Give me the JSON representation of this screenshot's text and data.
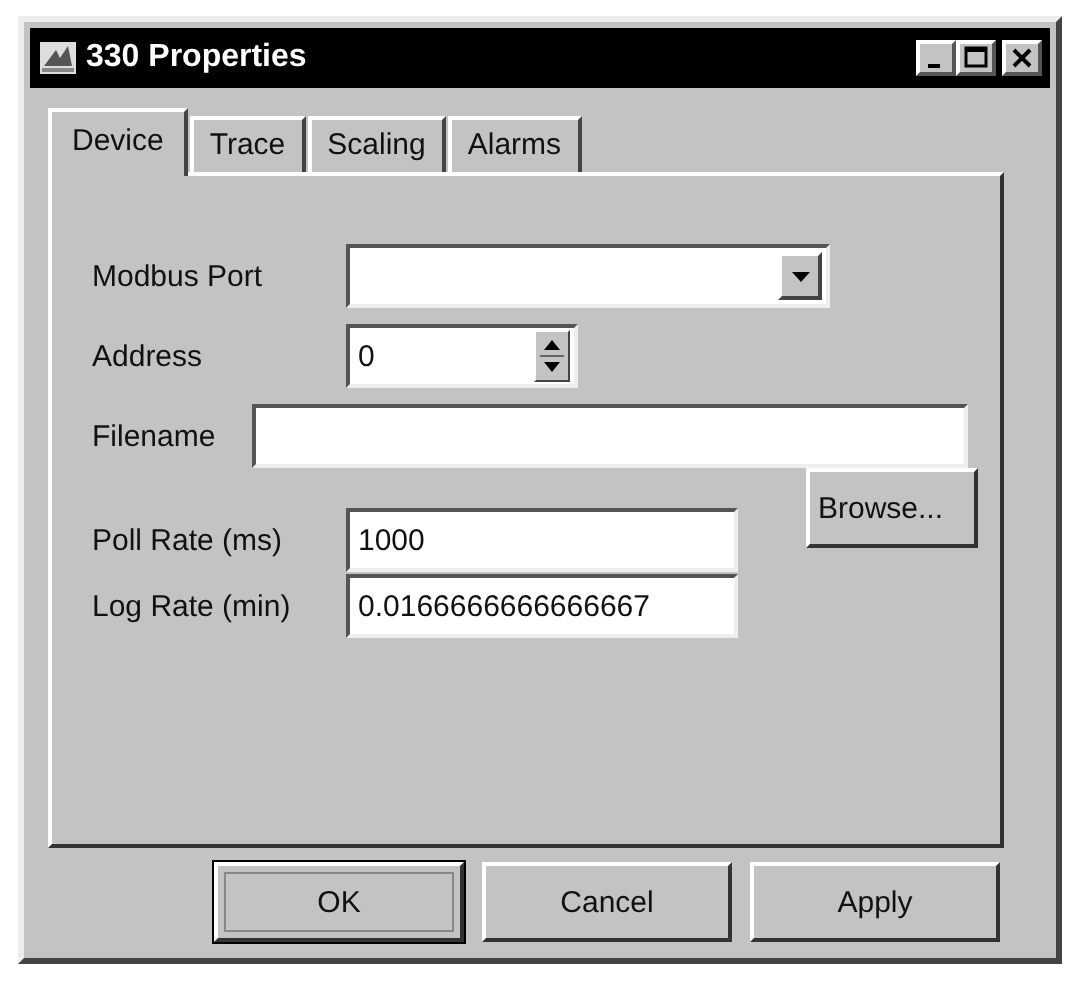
{
  "window": {
    "title": "330 Properties"
  },
  "tabs": [
    {
      "label": "Device",
      "selected": true
    },
    {
      "label": "Trace",
      "selected": false
    },
    {
      "label": "Scaling",
      "selected": false
    },
    {
      "label": "Alarms",
      "selected": false
    }
  ],
  "fields": [
    {
      "kind": "combo",
      "label": "Modbus Port"
    },
    {
      "kind": "spin",
      "label": "Address",
      "value": "0"
    },
    {
      "kind": "file",
      "label": "Filename",
      "button": "Browse..."
    },
    {
      "kind": "text",
      "label": "Poll Rate (ms)",
      "value": "1000"
    },
    {
      "kind": "text",
      "label": "Log Rate (min)",
      "value": "0.0166666666666667"
    }
  ],
  "buttons": [
    {
      "label": "OK",
      "default": true
    },
    {
      "label": "Cancel",
      "default": false
    },
    {
      "label": "Apply",
      "default": false
    }
  ]
}
